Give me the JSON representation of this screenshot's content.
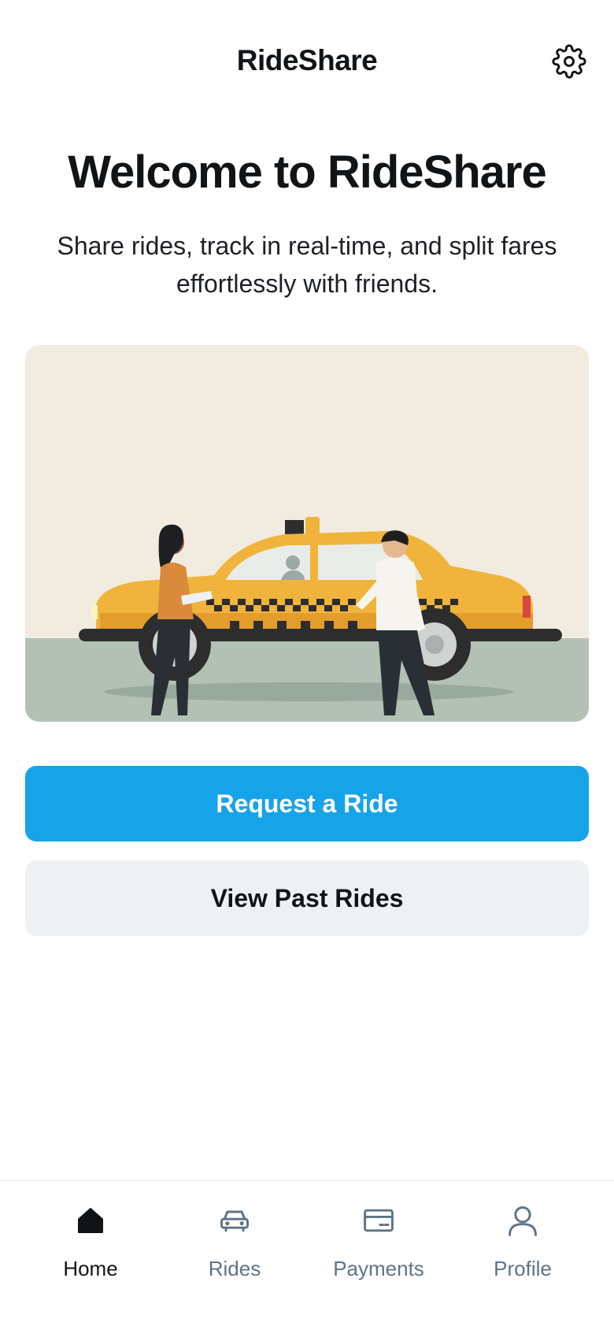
{
  "header": {
    "title": "RideShare",
    "settings_icon": "gear-icon"
  },
  "hero": {
    "title": "Welcome to RideShare",
    "subtitle": "Share rides, track in real-time, and split fares effortlessly with friends."
  },
  "illustration": {
    "subject": "taxi-with-passengers"
  },
  "actions": {
    "primary_label": "Request a Ride",
    "secondary_label": "View Past Rides"
  },
  "bottom_nav": {
    "items": [
      {
        "label": "Home",
        "icon": "home-icon",
        "active": true
      },
      {
        "label": "Rides",
        "icon": "car-icon",
        "active": false
      },
      {
        "label": "Payments",
        "icon": "card-icon",
        "active": false
      },
      {
        "label": "Profile",
        "icon": "user-icon",
        "active": false
      }
    ]
  },
  "colors": {
    "accent": "#16a3e8",
    "secondary_button": "#eef1f3",
    "text": "#111417",
    "nav_inactive": "#5e7486",
    "taxi": "#f0b43c"
  }
}
